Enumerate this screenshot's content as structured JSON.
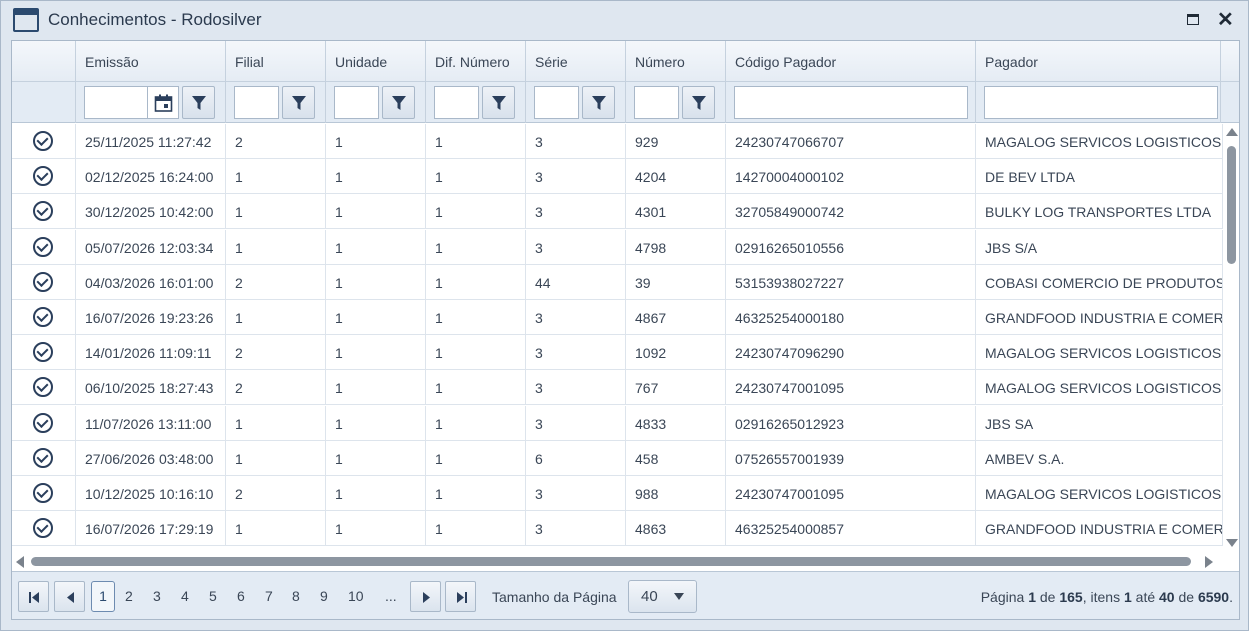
{
  "window": {
    "title": "Conhecimentos - Rodosilver"
  },
  "columns": [
    "Emissão",
    "Filial",
    "Unidade",
    "Dif. Número",
    "Série",
    "Número",
    "Código Pagador",
    "Pagador"
  ],
  "rows": [
    [
      "25/11/2025 11:27:42",
      "2",
      "1",
      "1",
      "3",
      "929",
      "24230747066707",
      "MAGALOG SERVICOS LOGISTICOS"
    ],
    [
      "02/12/2025 16:24:00",
      "1",
      "1",
      "1",
      "3",
      "4204",
      "14270004000102",
      "DE BEV LTDA"
    ],
    [
      "30/12/2025 10:42:00",
      "1",
      "1",
      "1",
      "3",
      "4301",
      "32705849000742",
      "BULKY LOG TRANSPORTES LTDA"
    ],
    [
      "05/07/2026 12:03:34",
      "1",
      "1",
      "1",
      "3",
      "4798",
      "02916265010556",
      "JBS S/A"
    ],
    [
      "04/03/2026 16:01:00",
      "2",
      "1",
      "1",
      "44",
      "39",
      "53153938027227",
      "COBASI COMERCIO DE PRODUTOS"
    ],
    [
      "16/07/2026 19:23:26",
      "1",
      "1",
      "1",
      "3",
      "4867",
      "46325254000180",
      "GRANDFOOD INDUSTRIA E COMERCIO"
    ],
    [
      "14/01/2026 11:09:11",
      "2",
      "1",
      "1",
      "3",
      "1092",
      "24230747096290",
      "MAGALOG SERVICOS LOGISTICOS"
    ],
    [
      "06/10/2025 18:27:43",
      "2",
      "1",
      "1",
      "3",
      "767",
      "24230747001095",
      "MAGALOG SERVICOS LOGISTICOS"
    ],
    [
      "11/07/2026 13:11:00",
      "1",
      "1",
      "1",
      "3",
      "4833",
      "02916265012923",
      "JBS SA"
    ],
    [
      "27/06/2026 03:48:00",
      "1",
      "1",
      "1",
      "6",
      "458",
      "07526557001939",
      "AMBEV S.A."
    ],
    [
      "10/12/2025 10:16:10",
      "2",
      "1",
      "1",
      "3",
      "988",
      "24230747001095",
      "MAGALOG SERVICOS LOGISTICOS"
    ],
    [
      "16/07/2026 17:29:19",
      "1",
      "1",
      "1",
      "3",
      "4863",
      "46325254000857",
      "GRANDFOOD INDUSTRIA E COMERCIO"
    ]
  ],
  "pager": {
    "pages": [
      "1",
      "2",
      "3",
      "4",
      "5",
      "6",
      "7",
      "8",
      "9",
      "10",
      "..."
    ],
    "active_page": "1",
    "page_size_label": "Tamanho da Página",
    "page_size": "40",
    "info": {
      "prefix": "Página",
      "page": "1",
      "of1": "de",
      "total_pages": "165",
      "items": ", itens",
      "from": "1",
      "to_word": "até",
      "to": "40",
      "of2": "de",
      "total": "6590",
      "end": "."
    }
  }
}
